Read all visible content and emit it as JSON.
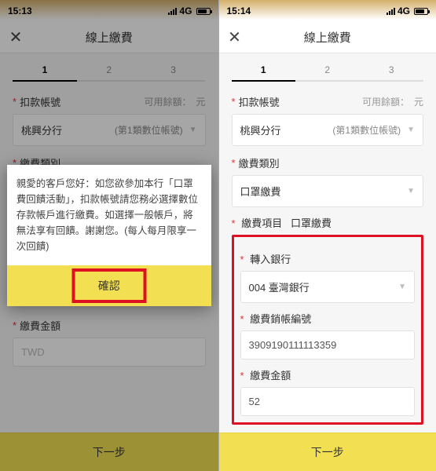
{
  "left": {
    "status": {
      "time": "15:13",
      "network": "4G"
    },
    "nav": {
      "title": "線上繳費"
    },
    "steps": [
      "1",
      "2",
      "3"
    ],
    "account": {
      "label": "扣款帳號",
      "balanceLabel": "可用餘額：",
      "unit": "元",
      "bank": "桃興分行",
      "accountType": "(第1類數位帳號)"
    },
    "category": {
      "label": "繳費類別"
    },
    "amount": {
      "label": "繳費金額",
      "placeholder": "TWD"
    },
    "next": "下一步",
    "modal": {
      "body": "親愛的客戶您好：如您欲參加本行「口罩費回饋活動」，扣款帳號請您務必選擇數位存款帳戶進行繳費。如選擇一般帳戶，將無法享有回饋。謝謝您。(每人每月限享一次回饋)",
      "confirm": "確認"
    }
  },
  "right": {
    "status": {
      "time": "15:14",
      "network": "4G"
    },
    "nav": {
      "title": "線上繳費"
    },
    "steps": [
      "1",
      "2",
      "3"
    ],
    "account": {
      "label": "扣款帳號",
      "balanceLabel": "可用餘額：",
      "unit": "元",
      "bank": "桃興分行",
      "accountType": "(第1類數位帳號)"
    },
    "category": {
      "label": "繳費類別",
      "value": "口罩繳費"
    },
    "item": {
      "label": "繳費項目",
      "value": "口罩繳費"
    },
    "transferBank": {
      "label": "轉入銀行",
      "value": "004 臺灣銀行"
    },
    "payNumber": {
      "label": "繳費銷帳編號",
      "value": "3909190111113359"
    },
    "amount": {
      "label": "繳費金額",
      "value": "52"
    },
    "next": "下一步"
  }
}
